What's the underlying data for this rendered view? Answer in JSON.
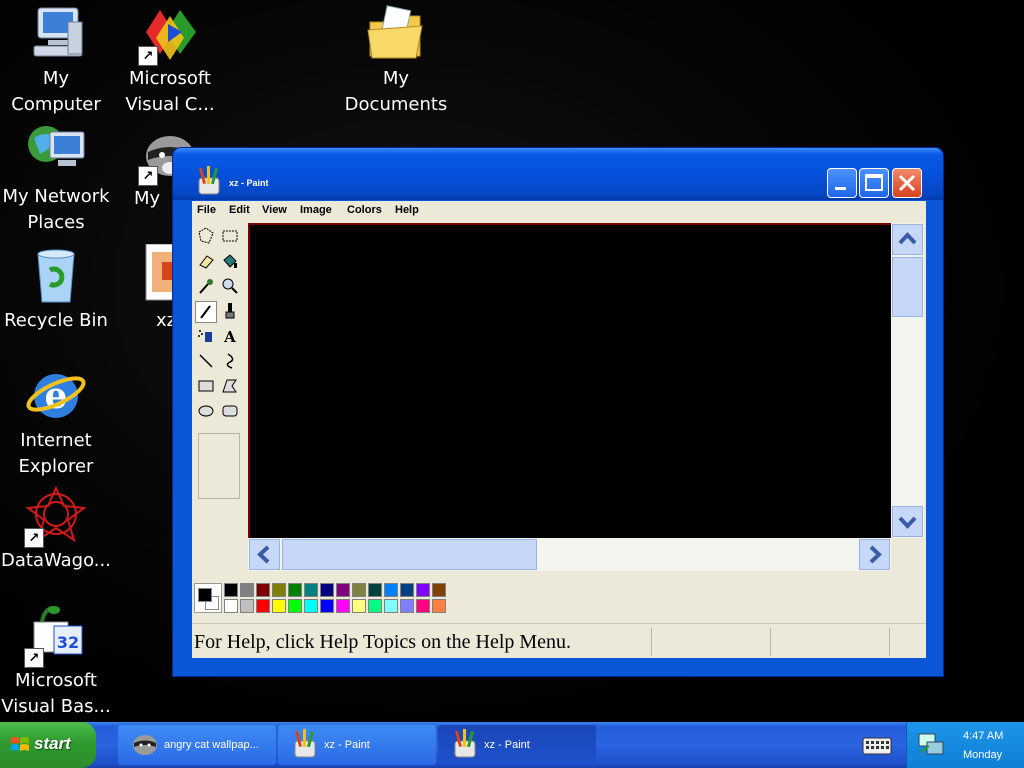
{
  "desktop": {
    "icons": [
      {
        "label": "My Computer",
        "icon": "my-computer-icon"
      },
      {
        "label": "Microsoft Visual C...",
        "icon": "visual-studio-icon",
        "shortcut": true
      },
      {
        "label": "My Documents",
        "icon": "folder-icon"
      },
      {
        "label": "My Network Places",
        "icon": "network-places-icon"
      },
      {
        "label": "My",
        "icon": "raccoon-icon",
        "shortcut": true
      },
      {
        "label": "Recycle Bin",
        "icon": "recycle-bin-icon"
      },
      {
        "label": "xz",
        "icon": "image-file-icon"
      },
      {
        "label": "Internet Explorer",
        "icon": "internet-explorer-icon"
      },
      {
        "label": "DataWago...",
        "icon": "datawagon-icon",
        "shortcut": true
      },
      {
        "label": "Microsoft Visual Bas...",
        "icon": "visual-basic-icon",
        "shortcut": true
      }
    ]
  },
  "window": {
    "title": "xz - Paint",
    "menu": [
      "File",
      "Edit",
      "View",
      "Image",
      "Colors",
      "Help"
    ],
    "status": "For Help, click Help Topics on the Help Menu."
  },
  "palette": {
    "row1": [
      "#000000",
      "#808080",
      "#800000",
      "#808000",
      "#008000",
      "#008080",
      "#000080",
      "#800080",
      "#808040",
      "#004040",
      "#0080ff",
      "#004080",
      "#8000ff",
      "#804000"
    ],
    "row2": [
      "#ffffff",
      "#c0c0c0",
      "#ff0000",
      "#ffff00",
      "#00ff00",
      "#00ffff",
      "#0000ff",
      "#ff00ff",
      "#ffff80",
      "#00ff80",
      "#80ffff",
      "#8080ff",
      "#ff0080",
      "#ff8040"
    ]
  },
  "taskbar": {
    "start_label": "start",
    "tasks": [
      {
        "label": "angry cat wallpap...",
        "icon": "raccoon-icon"
      },
      {
        "label": "xz - Paint",
        "icon": "paint-icon"
      },
      {
        "label": "xz - Paint",
        "icon": "paint-icon"
      }
    ],
    "clock_time": "4:47 AM",
    "clock_day": "Monday"
  }
}
